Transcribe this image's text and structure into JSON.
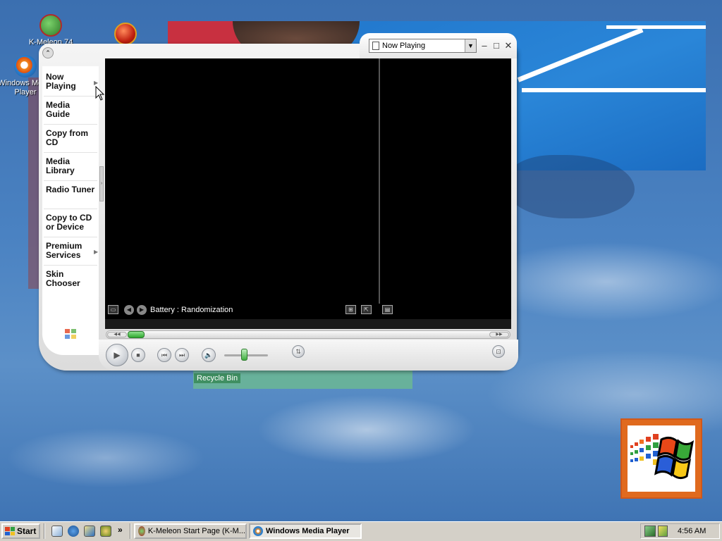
{
  "desktop": {
    "icons": [
      {
        "label": "K-Meleon 74",
        "icon": "k-meleon-icon"
      },
      {
        "label": "",
        "icon": "red-circle-app-icon"
      },
      {
        "label": "Windows Media Player",
        "icon": "windows-media-player-icon"
      }
    ],
    "recycle_bin_label": "Recycle Bin"
  },
  "wmp": {
    "dropdown_value": "Now Playing",
    "menu": [
      {
        "label": "Now Playing",
        "has_arrow": true
      },
      {
        "label": "Media Guide"
      },
      {
        "label": "Copy from CD"
      },
      {
        "label": "Media Library"
      },
      {
        "label": "Radio Tuner"
      },
      {
        "label": "Copy to CD or Device"
      },
      {
        "label": "Premium Services",
        "has_arrow": true
      },
      {
        "label": "Skin Chooser"
      }
    ],
    "visualization_text": "Battery : Randomization",
    "seek_progress": 0.0
  },
  "taskbar": {
    "start_label": "Start",
    "quick_launch_more": "»",
    "tasks": [
      {
        "label": "K-Meleon Start Page (K-M...",
        "active": false
      },
      {
        "label": "Windows Media Player",
        "active": true
      }
    ],
    "clock": "4:56 AM"
  },
  "colors": {
    "desktop_blue": "#3a6ea5",
    "taskbar_gray": "#d4d0c8",
    "seek_green": "#2fa82f"
  }
}
